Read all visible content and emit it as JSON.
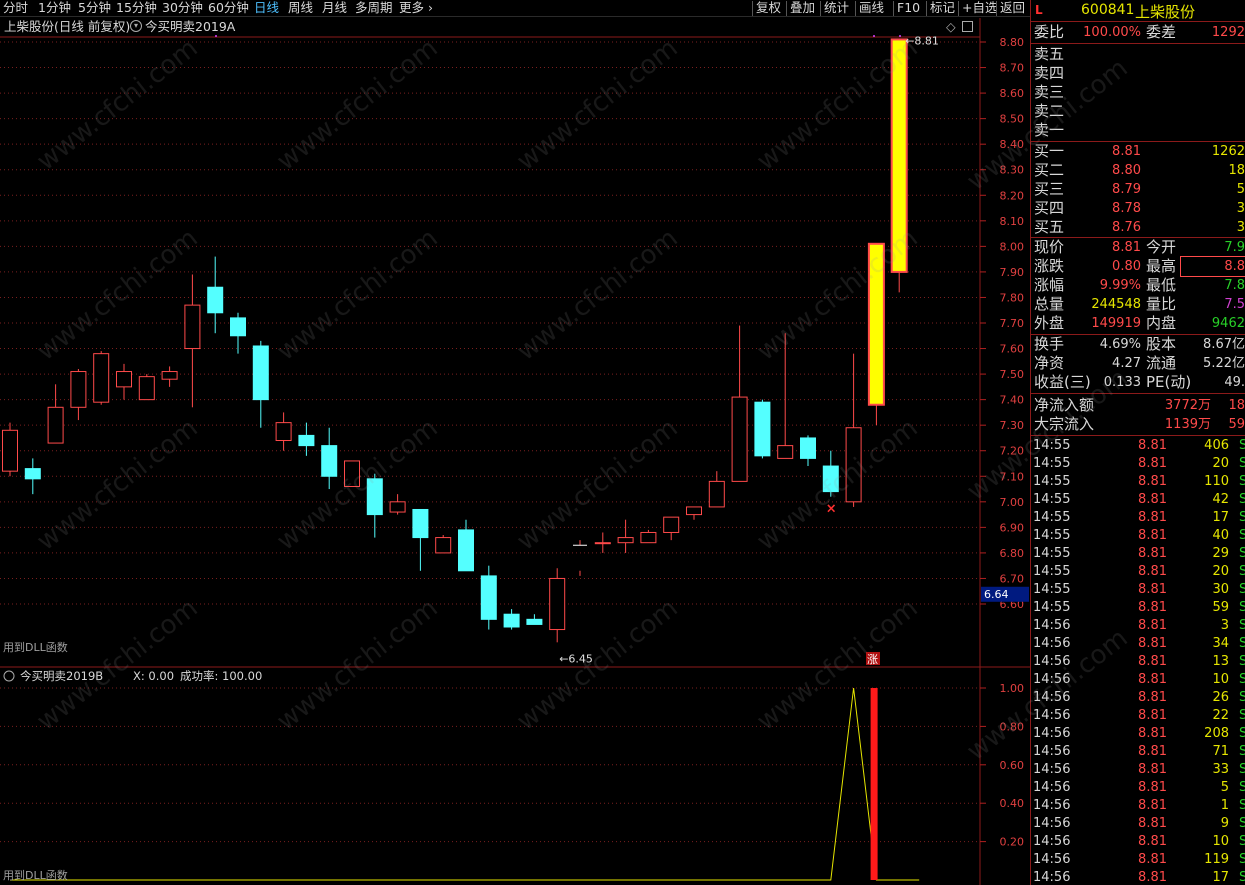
{
  "toolbar": {
    "periods": [
      "分时",
      "1分钟",
      "5分钟",
      "15分钟",
      "30分钟",
      "60分钟",
      "日线",
      "周线",
      "月线",
      "多周期",
      "更多 ›"
    ],
    "active": "日线",
    "actions": [
      "复权",
      "叠加",
      "统计",
      "画线",
      "F10",
      "标记",
      "+自选",
      "返回"
    ]
  },
  "header": {
    "stock_info": "上柴股份(日线 前复权)",
    "indicator": "今买明卖2019A"
  },
  "chart_data": [
    {
      "type": "candlestick",
      "title": "",
      "y_ticks": [
        "8.80",
        "8.70",
        "8.60",
        "8.50",
        "8.40",
        "8.30",
        "8.20",
        "8.10",
        "8.00",
        "7.90",
        "7.80",
        "7.70",
        "7.60",
        "7.50",
        "7.40",
        "7.30",
        "7.20",
        "7.10",
        "7.00",
        "6.90",
        "6.80",
        "6.70",
        "6.60"
      ],
      "ylim": [
        6.38,
        8.86
      ],
      "current_price_label": "6.64",
      "high_marker": "8.81",
      "low_marker": "6.45",
      "bottom_label": "用到DLL函数",
      "zhang_label": "涨",
      "candles": [
        [
          7.12,
          7.28,
          7.31,
          7.1
        ],
        [
          7.13,
          7.09,
          7.17,
          7.03
        ],
        [
          7.23,
          7.37,
          7.46,
          7.23
        ],
        [
          7.37,
          7.51,
          7.52,
          7.32
        ],
        [
          7.39,
          7.58,
          7.59,
          7.38
        ],
        [
          7.45,
          7.51,
          7.54,
          7.4
        ],
        [
          7.4,
          7.49,
          7.5,
          7.4
        ],
        [
          7.48,
          7.51,
          7.53,
          7.45
        ],
        [
          7.6,
          7.77,
          7.89,
          7.37
        ],
        [
          7.84,
          7.74,
          7.96,
          7.66
        ],
        [
          7.72,
          7.65,
          7.74,
          7.58
        ],
        [
          7.61,
          7.4,
          7.63,
          7.29
        ],
        [
          7.24,
          7.31,
          7.35,
          7.2
        ],
        [
          7.26,
          7.22,
          7.31,
          7.18
        ],
        [
          7.22,
          7.1,
          7.29,
          7.05
        ],
        [
          7.06,
          7.16,
          7.16,
          7.06
        ],
        [
          7.09,
          6.95,
          7.11,
          6.86
        ],
        [
          6.96,
          7.0,
          7.03,
          6.95
        ],
        [
          6.97,
          6.86,
          6.97,
          6.73
        ],
        [
          6.8,
          6.86,
          6.87,
          6.8
        ],
        [
          6.89,
          6.73,
          6.93,
          6.73
        ],
        [
          6.71,
          6.54,
          6.75,
          6.5
        ],
        [
          6.56,
          6.51,
          6.58,
          6.5
        ],
        [
          6.54,
          6.52,
          6.56,
          6.52
        ],
        [
          6.5,
          6.7,
          6.74,
          6.45
        ],
        [
          6.73,
          6.83,
          6.85,
          6.71
        ],
        [
          6.84,
          6.84,
          6.88,
          6.8
        ],
        [
          6.84,
          6.86,
          6.93,
          6.8
        ],
        [
          6.84,
          6.88,
          6.89,
          6.84
        ],
        [
          6.88,
          6.94,
          6.94,
          6.85
        ],
        [
          6.95,
          6.98,
          6.98,
          6.93
        ],
        [
          6.98,
          7.08,
          7.12,
          6.98
        ],
        [
          7.08,
          7.41,
          7.69,
          7.08
        ],
        [
          7.39,
          7.18,
          7.4,
          7.17
        ],
        [
          7.17,
          7.22,
          7.66,
          7.17
        ],
        [
          7.25,
          7.17,
          7.26,
          7.14
        ],
        [
          7.14,
          7.04,
          7.2,
          7.02
        ],
        [
          7.0,
          7.29,
          7.58,
          6.98
        ],
        [
          7.38,
          8.01,
          8.01,
          7.3
        ],
        [
          7.9,
          8.81,
          8.81,
          7.82
        ]
      ],
      "limit_up_index": [
        38,
        39
      ],
      "cross_marker_index": 36,
      "open_cross_index": 25
    },
    {
      "type": "line",
      "title": "今买明卖2019B",
      "x_label": "X: 0.00",
      "success_rate": "成功率: 100.00",
      "y_ticks": [
        "1.00",
        "0.80",
        "0.60",
        "0.40",
        "0.20"
      ],
      "ylim": [
        0,
        1.1
      ],
      "series": [
        {
          "values": [
            0,
            0,
            0,
            0,
            0,
            0,
            0,
            0,
            0,
            0,
            0,
            0,
            0,
            0,
            0,
            0,
            0,
            0,
            0,
            0,
            0,
            0,
            0,
            0,
            0,
            0,
            0,
            0,
            0,
            0,
            0,
            0,
            0,
            0,
            0,
            0,
            0,
            1,
            0,
            0
          ]
        }
      ],
      "bar_index": 37,
      "bar_value": 1.0,
      "bottom_label": "用到DLL函数"
    }
  ],
  "panel": {
    "code": "600841",
    "name": "上柴股份",
    "L": "L",
    "weibi_label": "委比",
    "weibi": "100.00%",
    "weicha_label": "委差",
    "weicha": "1292",
    "sells": [
      "卖五",
      "卖四",
      "卖三",
      "卖二",
      "卖一"
    ],
    "buys": [
      {
        "label": "买一",
        "price": "8.81",
        "vol": "1262"
      },
      {
        "label": "买二",
        "price": "8.80",
        "vol": "18"
      },
      {
        "label": "买三",
        "price": "8.79",
        "vol": "5"
      },
      {
        "label": "买四",
        "price": "8.78",
        "vol": "3"
      },
      {
        "label": "买五",
        "price": "8.76",
        "vol": "3"
      }
    ],
    "stats": [
      {
        "l1": "现价",
        "v1": "8.81",
        "c1": "#ff4a4a",
        "l2": "今开",
        "v2": "7.9",
        "c2": "#28d028"
      },
      {
        "l1": "涨跌",
        "v1": "0.80",
        "c1": "#ff4a4a",
        "l2": "最高",
        "v2": "8.8",
        "c2": "#ff4a4a"
      },
      {
        "l1": "涨幅",
        "v1": "9.99%",
        "c1": "#ff4a4a",
        "l2": "最低",
        "v2": "7.8",
        "c2": "#28d028"
      },
      {
        "l1": "总量",
        "v1": "244548",
        "c1": "#e6e600",
        "l2": "量比",
        "v2": "7.5",
        "c2": "#d040d0"
      },
      {
        "l1": "外盘",
        "v1": "149919",
        "c1": "#ff4a4a",
        "l2": "内盘",
        "v2": "9462",
        "c2": "#28d028"
      }
    ],
    "fundamentals": [
      {
        "l1": "换手",
        "v1": "4.69%",
        "l2": "股本",
        "v2": "8.67亿"
      },
      {
        "l1": "净资",
        "v1": "4.27",
        "l2": "流通",
        "v2": "5.22亿"
      },
      {
        "l1": "收益(三)",
        "v1": "0.133",
        "l2": "PE(动)",
        "v2": "49."
      }
    ],
    "flows": [
      {
        "label": "净流入额",
        "val": "3772万",
        "extra": "18"
      },
      {
        "label": "大宗流入",
        "val": "1139万",
        "extra": "59"
      }
    ],
    "ticks": [
      [
        "14:55",
        "8.81",
        "406",
        "S"
      ],
      [
        "14:55",
        "8.81",
        "20",
        "S"
      ],
      [
        "14:55",
        "8.81",
        "110",
        "S"
      ],
      [
        "14:55",
        "8.81",
        "42",
        "S"
      ],
      [
        "14:55",
        "8.81",
        "17",
        "S"
      ],
      [
        "14:55",
        "8.81",
        "40",
        "S"
      ],
      [
        "14:55",
        "8.81",
        "29",
        "S"
      ],
      [
        "14:55",
        "8.81",
        "20",
        "S"
      ],
      [
        "14:55",
        "8.81",
        "30",
        "S"
      ],
      [
        "14:55",
        "8.81",
        "59",
        "S"
      ],
      [
        "14:56",
        "8.81",
        "3",
        "S"
      ],
      [
        "14:56",
        "8.81",
        "34",
        "S"
      ],
      [
        "14:56",
        "8.81",
        "13",
        "S"
      ],
      [
        "14:56",
        "8.81",
        "10",
        "S"
      ],
      [
        "14:56",
        "8.81",
        "26",
        "S"
      ],
      [
        "14:56",
        "8.81",
        "22",
        "S"
      ],
      [
        "14:56",
        "8.81",
        "208",
        "S"
      ],
      [
        "14:56",
        "8.81",
        "71",
        "S"
      ],
      [
        "14:56",
        "8.81",
        "33",
        "S"
      ],
      [
        "14:56",
        "8.81",
        "5",
        "S"
      ],
      [
        "14:56",
        "8.81",
        "1",
        "S"
      ],
      [
        "14:56",
        "8.81",
        "9",
        "S"
      ],
      [
        "14:56",
        "8.81",
        "10",
        "S"
      ],
      [
        "14:56",
        "8.81",
        "119",
        "S"
      ],
      [
        "14:56",
        "8.81",
        "17",
        "S"
      ]
    ]
  },
  "watermark": "www.cfchi.com"
}
